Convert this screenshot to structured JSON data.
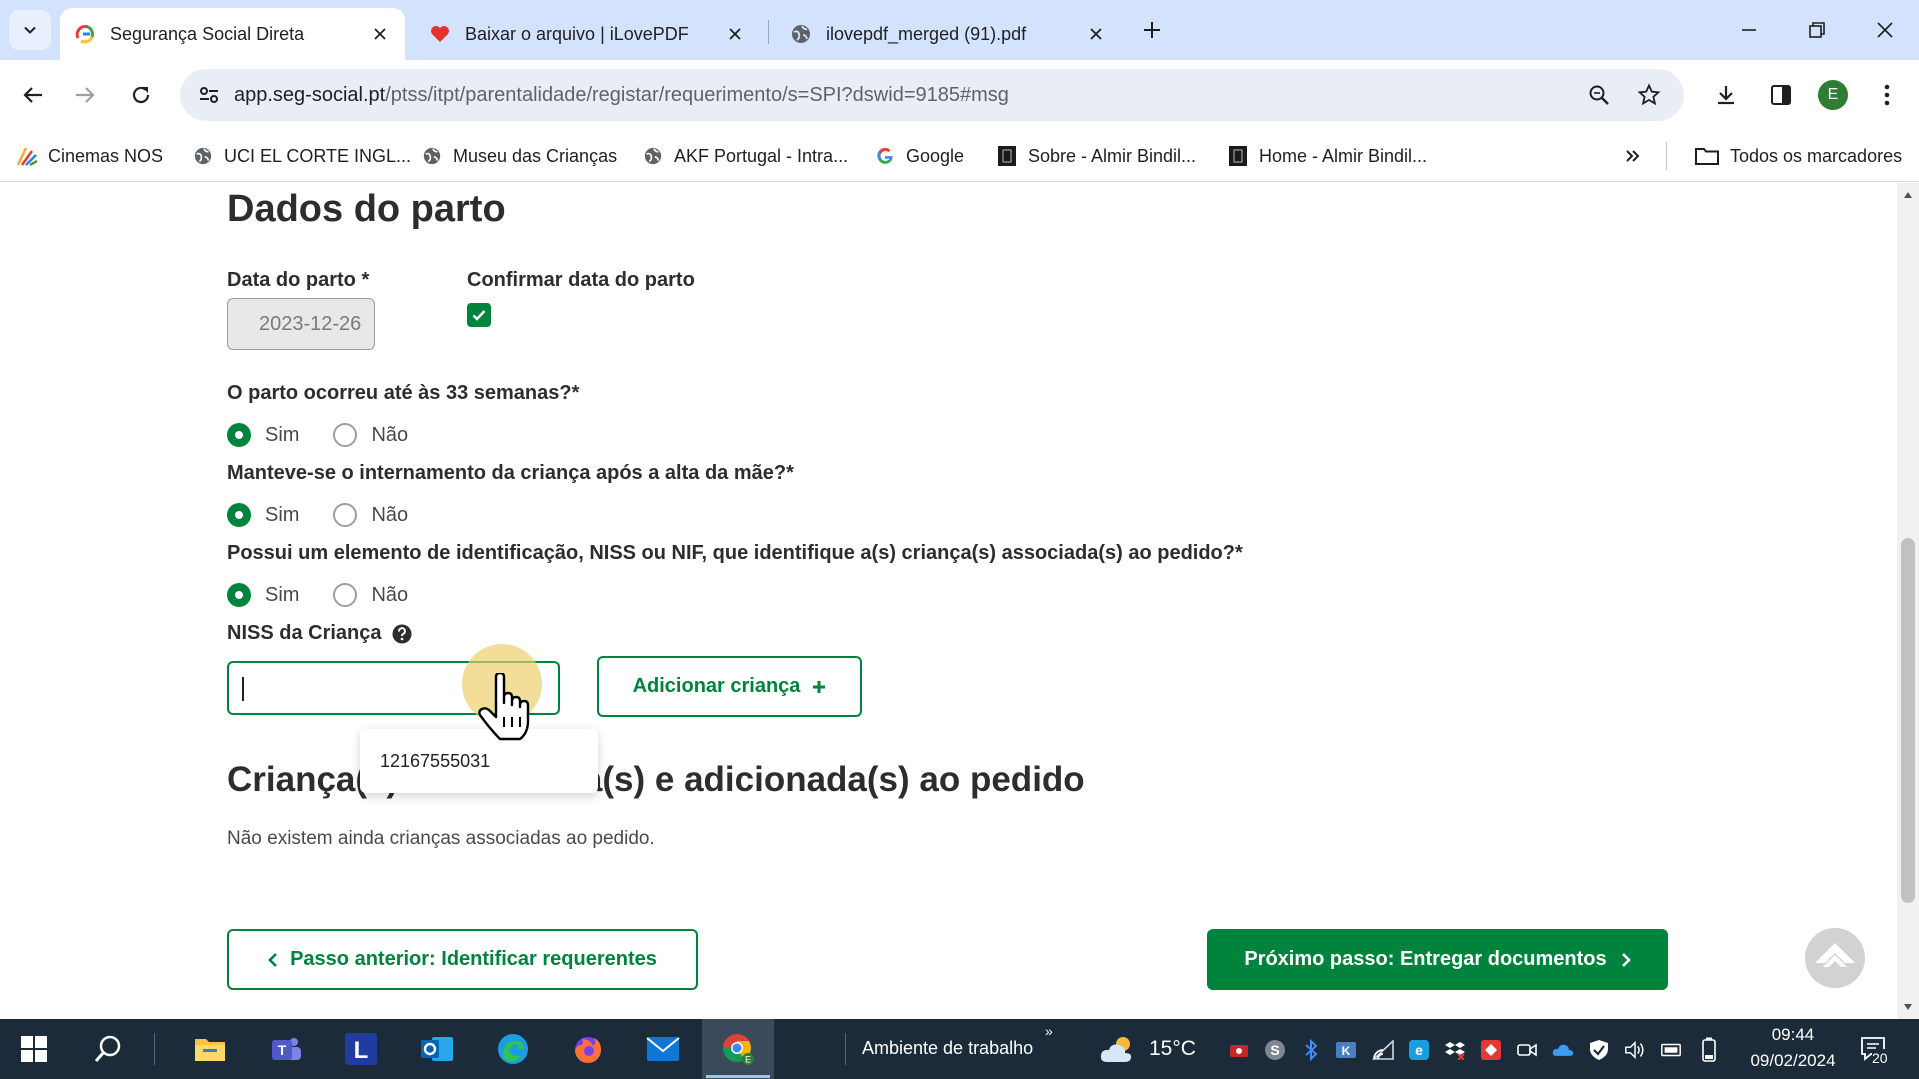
{
  "browser": {
    "tabs": [
      {
        "title": "Segurança Social Direta",
        "active": true,
        "icon": "seg-social-favicon"
      },
      {
        "title": "Baixar o arquivo | iLovePDF",
        "active": false,
        "icon": "heart-icon"
      },
      {
        "title": "ilovepdf_merged (91).pdf",
        "active": false,
        "icon": "globe-icon"
      }
    ],
    "url_host": "app.seg-social.pt",
    "url_path": "/ptss/itpt/parentalidade/registar/requerimento/s=SPI?dswid=9185#msg",
    "profile_initial": "E",
    "bookmarks": [
      {
        "label": "Cinemas NOS",
        "icon": "cinemas-nos-icon"
      },
      {
        "label": "UCI EL CORTE INGL...",
        "icon": "globe-icon"
      },
      {
        "label": "Museu das Crianças",
        "icon": "globe-icon"
      },
      {
        "label": "AKF Portugal - Intra...",
        "icon": "globe-icon"
      },
      {
        "label": "Google",
        "icon": "google-icon"
      },
      {
        "label": "Sobre - Almir Bindil...",
        "icon": "dark-square-icon"
      },
      {
        "label": "Home - Almir Bindil...",
        "icon": "dark-square-icon"
      }
    ],
    "all_bookmarks_label": "Todos os marcadores"
  },
  "form": {
    "section_title": "Dados do parto",
    "birth_date_label": "Data do parto *",
    "birth_date_value": "2023-12-26",
    "confirm_label": "Confirmar data do parto",
    "confirm_checked": true,
    "questions": [
      {
        "text": "O parto ocorreu até às 33 semanas?*",
        "yes": "Sim",
        "no": "Não",
        "selected": "Sim"
      },
      {
        "text": "Manteve-se o internamento da criança após a alta da mãe?*",
        "yes": "Sim",
        "no": "Não",
        "selected": "Sim"
      },
      {
        "text": "Possui um elemento de identificação, NISS ou NIF, que identifique a(s) criança(s) associada(s) ao pedido?*",
        "yes": "Sim",
        "no": "Não",
        "selected": "Sim"
      }
    ],
    "niss_label": "NISS da Criança",
    "niss_value": "",
    "autocomplete_suggestion": "12167555031",
    "add_child_label": "Adicionar criança",
    "children_title": "Criança(s) identificada(s) e adicionada(s) ao pedido",
    "no_children_text": "Não existem ainda crianças associadas ao pedido.",
    "prev_step_label": "Passo anterior: Identificar requerentes",
    "next_step_label": "Próximo passo: Entregar documentos",
    "accent_color": "#00843d"
  },
  "taskbar": {
    "desktop_label": "Ambiente de trabalho",
    "temperature": "15°C",
    "time": "09:44",
    "date": "09/02/2024",
    "notifications": "20"
  }
}
